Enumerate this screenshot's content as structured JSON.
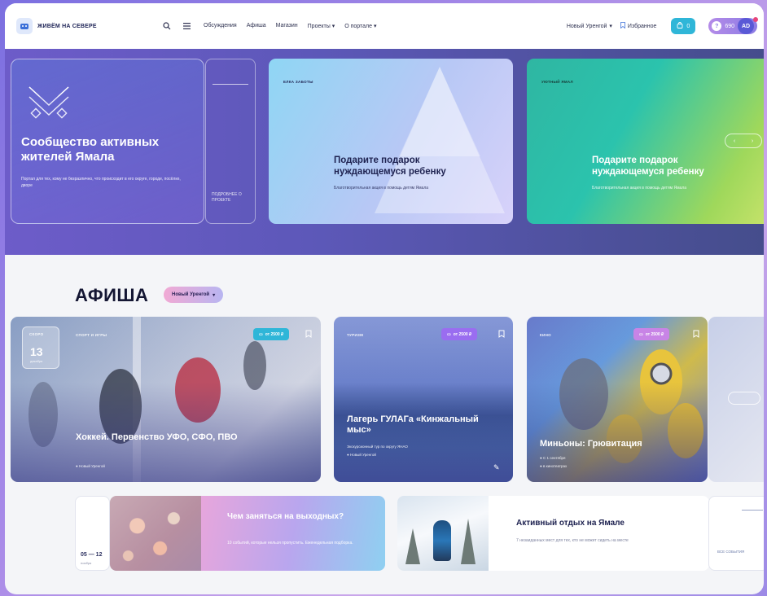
{
  "header": {
    "logo_text": "ЖИВЁМ НА СЕВЕРЕ",
    "nav": [
      "Обсуждения",
      "Афиша",
      "Магазин",
      "Проекты",
      "О портале"
    ],
    "city": "Новый Уренгой",
    "favorites": "Избранное",
    "cart_count": "0",
    "coins": "690",
    "avatar_initials": "AD"
  },
  "hero": {
    "title": "Сообщество активных жителей Ямала",
    "description": "Портал для тех, кому не безразлично, что происходит в его округе, городе, посёлке, дворе",
    "more_label": "ПОДРОБНЕЕ О ПРОЕКТЕ",
    "promos": [
      {
        "tag": "ЕЛКА ЗАБОТЫ",
        "title": "Подарите подарок нуждающемуся ребенку",
        "description": "Благотворительная акция в помощь детям Ямала"
      },
      {
        "tag": "УЮТНЫЙ ЯМАЛ",
        "title": "Подарите подарок нуждающемуся ребенку",
        "description": "Благотворительная акция в помощь детям Ямала"
      }
    ]
  },
  "afisha": {
    "title": "АФИША",
    "city": "Новый Уренгой",
    "cards": [
      {
        "date_label": "СКОРО",
        "day": "13",
        "month": "декабря",
        "category": "СПОРТ И ИГРЫ",
        "price": "от 2500 ₽",
        "title": "Хоккей. Первенство УФО, СФО, ПВО",
        "meta": "Новый Уренгой"
      },
      {
        "category": "ТУРИЗМ",
        "price": "от 2500 ₽",
        "title": "Лагерь ГУЛАГа «Кинжальный мыс»",
        "meta1": "Экскурсионный тур по округу ЯНАО",
        "meta2": "Новый Уренгой"
      },
      {
        "category": "КИНО",
        "price": "от 2500 ₽",
        "title": "Миньоны: Грювитация",
        "meta1": "С 1 сентября",
        "meta2": "в кинотеатрах"
      }
    ]
  },
  "bottom": {
    "week_dates": "05 — 12",
    "week_sub": "ноября",
    "weekend_title": "Чем заняться на выходных?",
    "weekend_desc": "10 событий, которые нельзя пропустить. Еженедельная подборка.",
    "active_title": "Активный отдых на Ямале",
    "active_desc": "7 незаиданных мест для тех, кто не может сидеть на месте",
    "all_events": "ВСЕ СОБЫТИЯ"
  },
  "colors": {
    "accent_blue": "#2fb6d8",
    "accent_purple": "#8c7ce4",
    "hero_bg": "#5d58b9",
    "price_cyan": "#2fb6d8",
    "price_purple": "#9a6df0",
    "price_pink": "#c884e6"
  }
}
